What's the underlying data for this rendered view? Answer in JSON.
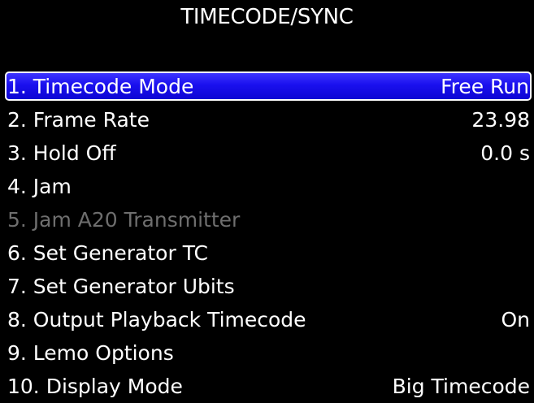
{
  "title": "TIMECODE/SYNC",
  "colors": {
    "background": "#000000",
    "text": "#ffffff",
    "selection": "#1a10ee",
    "disabled_text": "#6e6e6e"
  },
  "items": [
    {
      "label": "1. Timecode Mode",
      "value": "Free Run",
      "selected": true,
      "enabled": true
    },
    {
      "label": "2. Frame Rate",
      "value": "23.98",
      "selected": false,
      "enabled": true
    },
    {
      "label": "3. Hold Off",
      "value": "0.0 s",
      "selected": false,
      "enabled": true
    },
    {
      "label": "4. Jam",
      "value": "",
      "selected": false,
      "enabled": true
    },
    {
      "label": "5. Jam A20 Transmitter",
      "value": "",
      "selected": false,
      "enabled": false
    },
    {
      "label": "6. Set Generator TC",
      "value": "",
      "selected": false,
      "enabled": true
    },
    {
      "label": "7. Set Generator Ubits",
      "value": "",
      "selected": false,
      "enabled": true
    },
    {
      "label": "8. Output Playback Timecode",
      "value": "On",
      "selected": false,
      "enabled": true
    },
    {
      "label": "9. Lemo Options",
      "value": "",
      "selected": false,
      "enabled": true
    },
    {
      "label": "10. Display Mode",
      "value": "Big Timecode",
      "selected": false,
      "enabled": true
    }
  ]
}
